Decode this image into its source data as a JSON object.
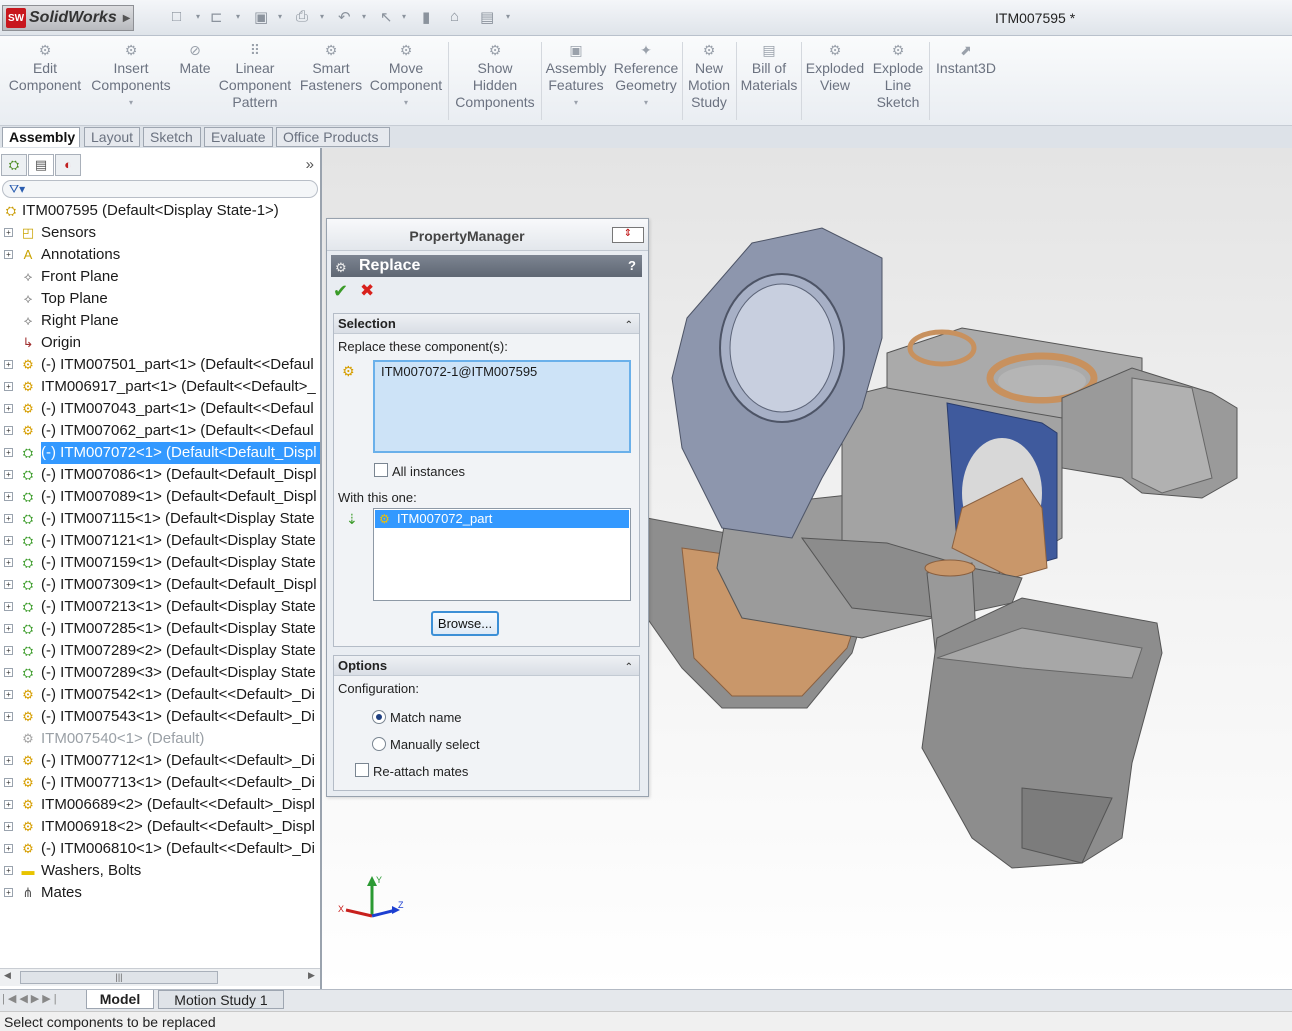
{
  "app": {
    "logo_text": "SolidWorks",
    "document_title": "ITM007595 *"
  },
  "ribbon": {
    "buttons": [
      {
        "label": "Edit\nComponent"
      },
      {
        "label": "Insert\nComponents"
      },
      {
        "label": "Mate"
      },
      {
        "label": "Linear\nComponent\nPattern"
      },
      {
        "label": "Smart\nFasteners"
      },
      {
        "label": "Move\nComponent"
      },
      {
        "label": "Show\nHidden\nComponents"
      },
      {
        "label": "Assembly\nFeatures"
      },
      {
        "label": "Reference\nGeometry"
      },
      {
        "label": "New\nMotion\nStudy"
      },
      {
        "label": "Bill of\nMaterials"
      },
      {
        "label": "Exploded\nView"
      },
      {
        "label": "Explode\nLine\nSketch"
      },
      {
        "label": "Instant3D"
      }
    ]
  },
  "command_tabs": [
    "Assembly",
    "Layout",
    "Sketch",
    "Evaluate",
    "Office Products"
  ],
  "tree": {
    "root": "ITM007595  (Default<Display State-1>)",
    "items": [
      {
        "label": "Sensors",
        "icon": "sensor-icon"
      },
      {
        "label": "Annotations",
        "icon": "annotation-icon"
      },
      {
        "label": "Front Plane",
        "icon": "plane-icon"
      },
      {
        "label": "Top Plane",
        "icon": "plane-icon"
      },
      {
        "label": "Right Plane",
        "icon": "plane-icon"
      },
      {
        "label": "Origin",
        "icon": "origin-icon"
      },
      {
        "label": "(-) ITM007501_part<1> (Default<<Defaul",
        "icon": "part-icon"
      },
      {
        "label": "ITM006917_part<1> (Default<<Default>_",
        "icon": "part-icon"
      },
      {
        "label": "(-) ITM007043_part<1> (Default<<Defaul",
        "icon": "part-icon"
      },
      {
        "label": "(-) ITM007062_part<1> (Default<<Defaul",
        "icon": "part-icon"
      },
      {
        "label": "(-) ITM007072<1> (Default<Default_Displ",
        "icon": "assembly-icon"
      },
      {
        "label": "(-) ITM007086<1> (Default<Default_Displ",
        "icon": "assembly-icon"
      },
      {
        "label": "(-) ITM007089<1> (Default<Default_Displ",
        "icon": "assembly-icon"
      },
      {
        "label": "(-) ITM007115<1> (Default<Display State",
        "icon": "assembly-icon"
      },
      {
        "label": "(-) ITM007121<1> (Default<Display State",
        "icon": "assembly-icon"
      },
      {
        "label": "(-) ITM007159<1> (Default<Display State",
        "icon": "assembly-icon"
      },
      {
        "label": "(-) ITM007309<1> (Default<Default_Displ",
        "icon": "assembly-icon"
      },
      {
        "label": "(-) ITM007213<1> (Default<Display State",
        "icon": "assembly-icon"
      },
      {
        "label": "(-) ITM007285<1> (Default<Display State",
        "icon": "assembly-icon"
      },
      {
        "label": "(-) ITM007289<2> (Default<Display State",
        "icon": "assembly-icon"
      },
      {
        "label": "(-) ITM007289<3> (Default<Display State",
        "icon": "assembly-icon"
      },
      {
        "label": "(-) ITM007542<1> (Default<<Default>_Di",
        "icon": "part-icon"
      },
      {
        "label": "(-) ITM007543<1> (Default<<Default>_Di",
        "icon": "part-icon"
      },
      {
        "label": "ITM007540<1> (Default)",
        "icon": "suppressed-part-icon"
      },
      {
        "label": "(-) ITM007712<1> (Default<<Default>_Di",
        "icon": "part-icon"
      },
      {
        "label": "(-) ITM007713<1> (Default<<Default>_Di",
        "icon": "part-icon"
      },
      {
        "label": "ITM006689<2> (Default<<Default>_Displ",
        "icon": "part-icon"
      },
      {
        "label": "ITM006918<2> (Default<<Default>_Displ",
        "icon": "part-icon"
      },
      {
        "label": "(-) ITM006810<1> (Default<<Default>_Di",
        "icon": "part-icon"
      },
      {
        "label": "Washers, Bolts",
        "icon": "folder-icon"
      },
      {
        "label": "Mates",
        "icon": "mates-icon"
      }
    ],
    "selected_index": 10,
    "suppressed_index": 23
  },
  "property_manager": {
    "header": "PropertyManager",
    "title": "Replace",
    "help": "?",
    "selection_group": "Selection",
    "replace_label": "Replace these component(s):",
    "replace_value": "ITM007072-1@ITM007595",
    "all_instances": "All instances",
    "with_label": "With this one:",
    "with_value": "ITM007072_part",
    "browse": "Browse...",
    "options_group": "Options",
    "configuration_label": "Configuration:",
    "match_name": "Match name",
    "manually_select": "Manually select",
    "reattach": "Re-attach mates"
  },
  "bottom_tabs": [
    "Model",
    "Motion Study 1"
  ],
  "status": "Select components to be replaced",
  "colors": {
    "selection": "#3399ff",
    "pm_title_bar": "#6a7280",
    "active_list": "#cde3f7",
    "ok": "#3a9b28",
    "cancel": "#d8211c"
  }
}
